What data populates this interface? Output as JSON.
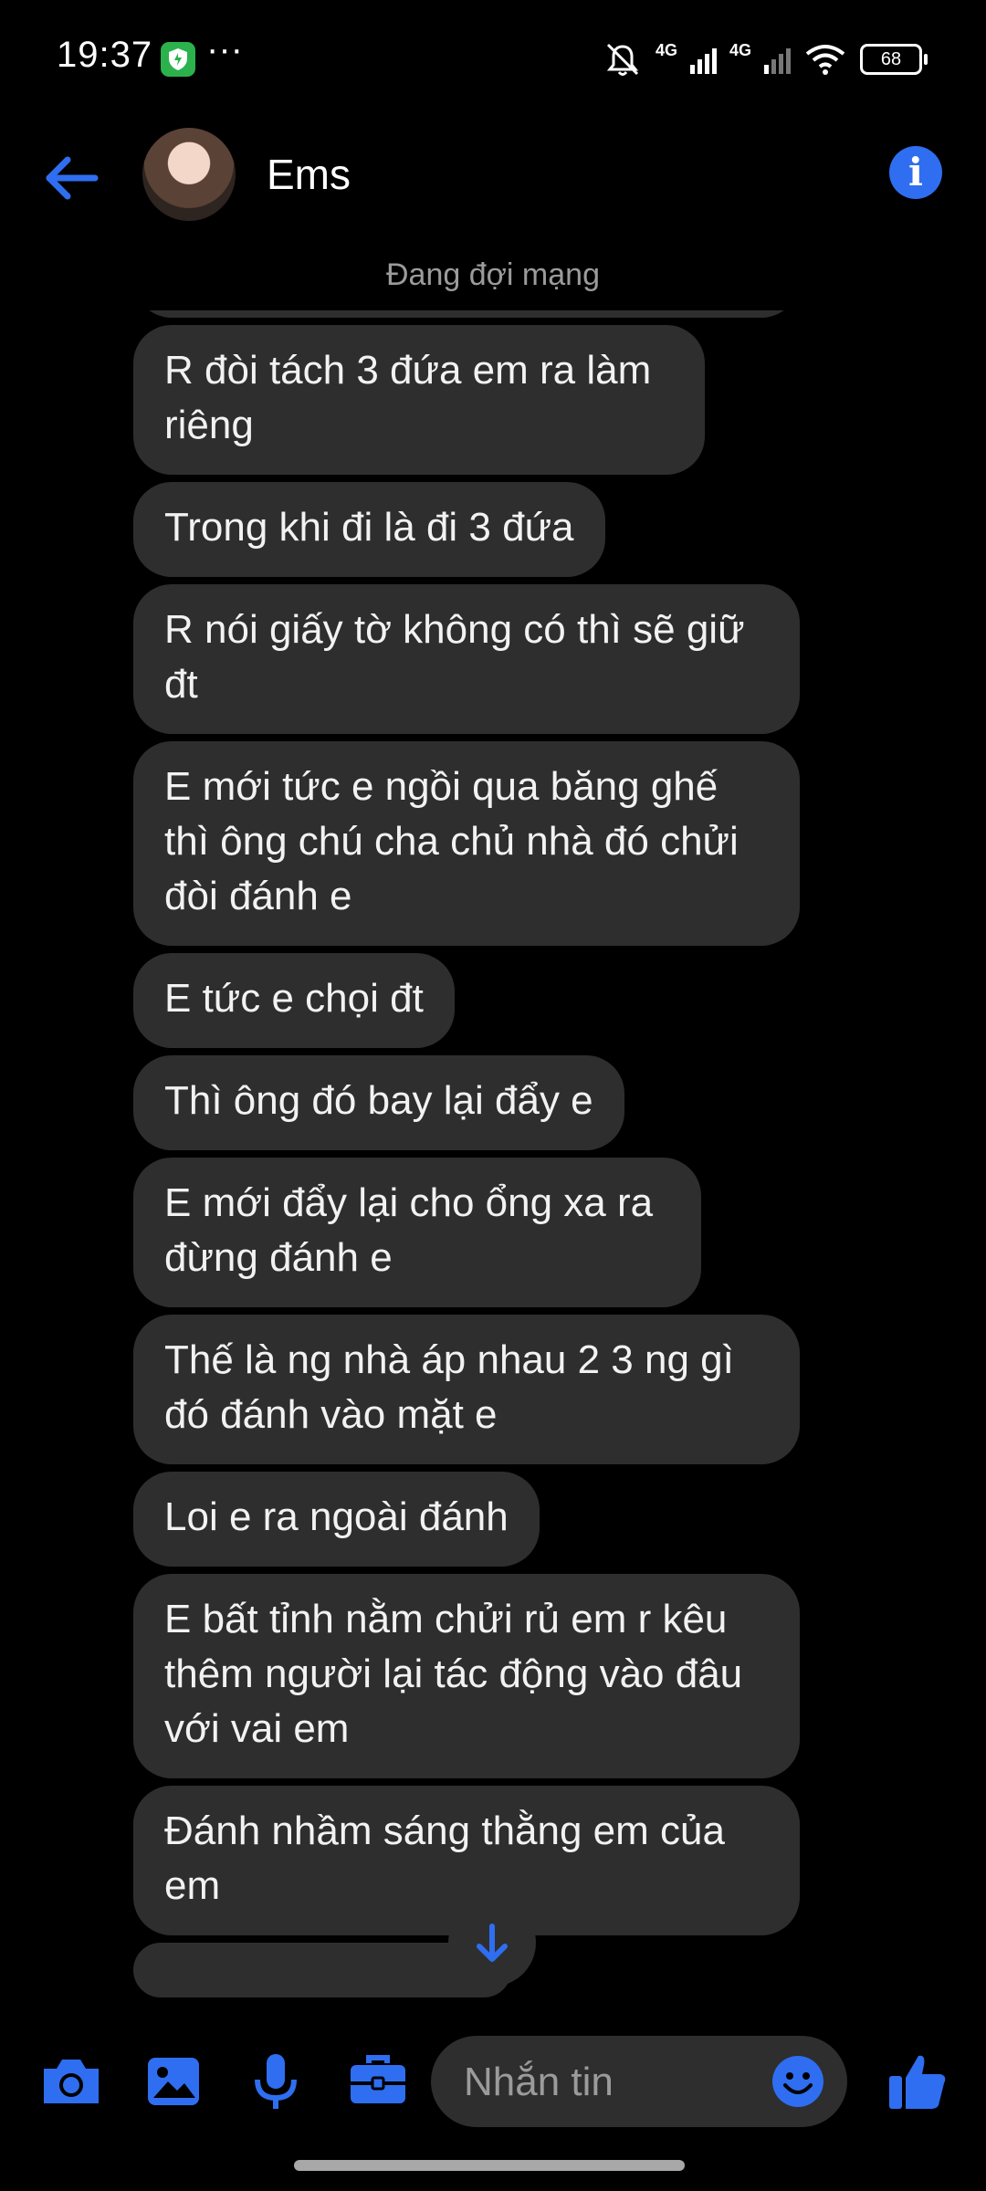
{
  "status_bar": {
    "time": "19:37",
    "more": "···",
    "network_1": "4G",
    "network_2": "4G",
    "battery": "68"
  },
  "header": {
    "contact_name": "Ems"
  },
  "network_status": "Đang đợi mạng",
  "messages": [
    "R đòi tách 3 đứa em ra làm riêng",
    "Trong khi đi là đi 3 đứa",
    "R nói giấy tờ không có thì sẽ giữ đt",
    "E mới tức e ngồi qua băng ghế thì ông chú cha chủ nhà đó chửi đòi đánh e",
    "E tức e chọi đt",
    "Thì ông đó bay lại đẩy e",
    "E mới đẩy lại cho ổng xa ra đừng đánh e",
    "Thế là ng nhà áp nhau 2 3 ng gì đó đánh vào mặt e",
    "Loi e ra ngoài đánh",
    "E bất tỉnh nằm chửi rủ em r kêu thêm người lại tác động vào đâu với vai em",
    "Đánh nhầm sáng thằng em của em"
  ],
  "composer": {
    "placeholder": "Nhắn tin"
  },
  "colors": {
    "accent": "#2f6ef0",
    "bubble": "#2e2e2f",
    "background": "#000000"
  },
  "icons": [
    "back-arrow-icon",
    "info-icon",
    "camera-icon",
    "image-icon",
    "microphone-icon",
    "briefcase-icon",
    "emoji-icon",
    "thumbs-up-icon",
    "arrow-down-icon"
  ]
}
